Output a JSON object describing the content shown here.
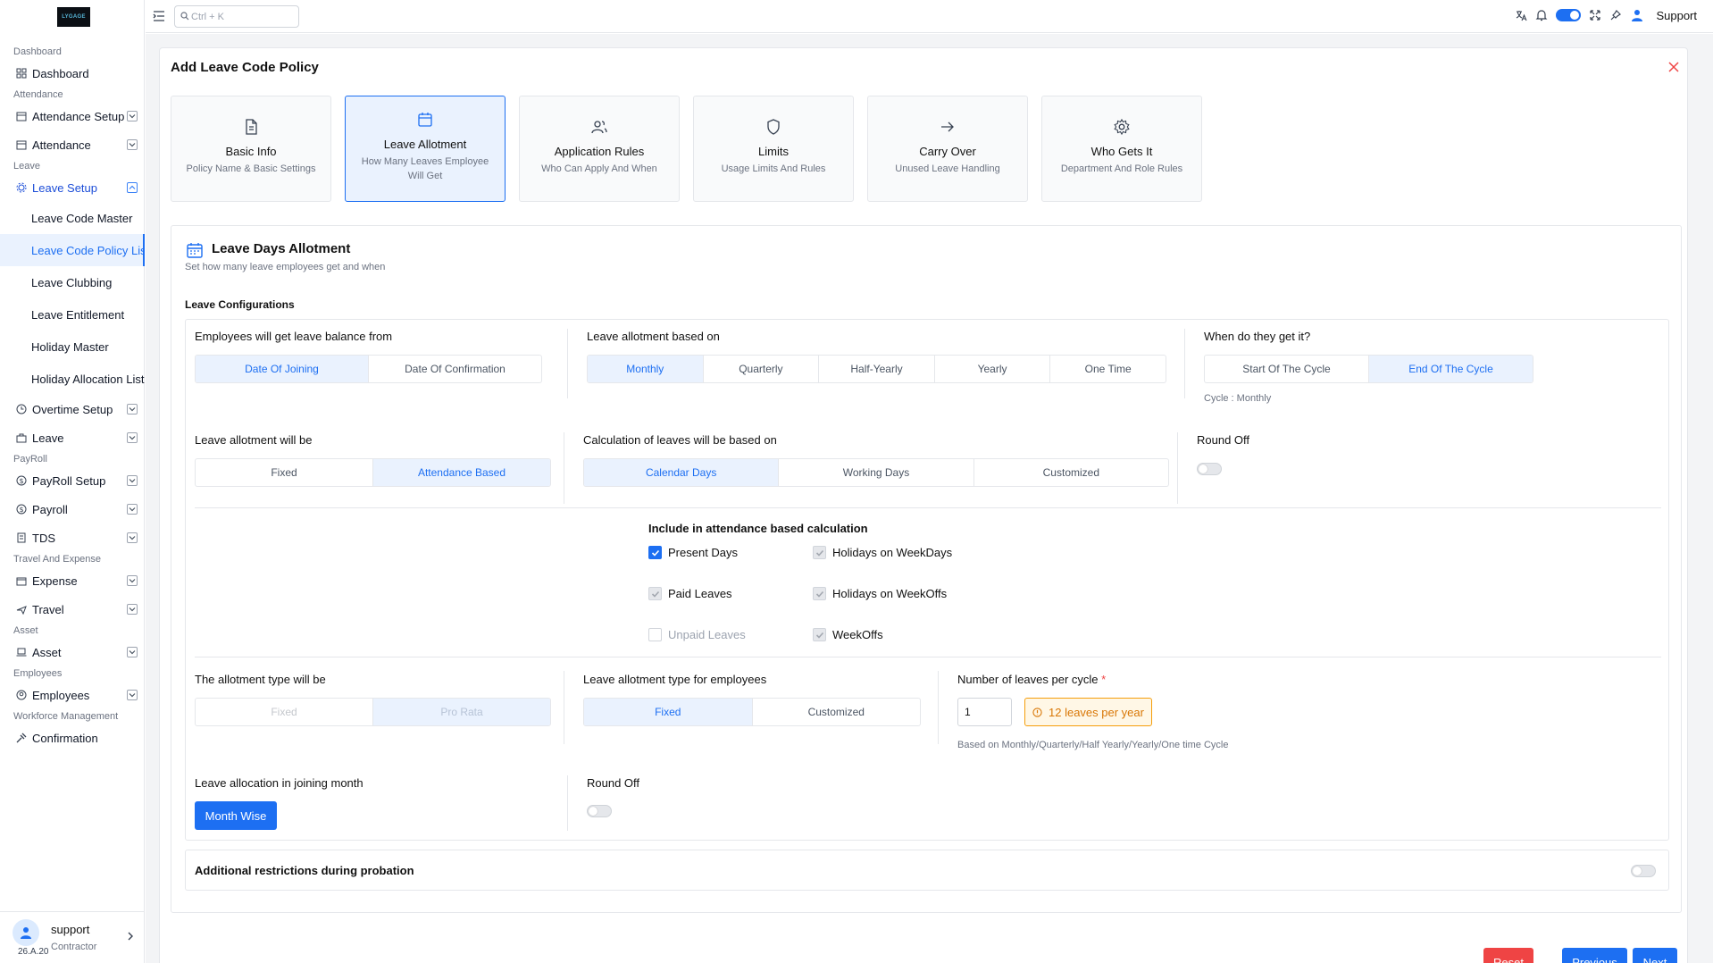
{
  "app": {
    "logo_text": "LYGAGE"
  },
  "topbar": {
    "search_placeholder": "Ctrl + K",
    "user_label": "Support"
  },
  "sidebar": {
    "sections": {
      "dashboard": "Dashboard",
      "attendance": "Attendance",
      "leave": "Leave",
      "payroll": "PayRoll",
      "travel": "Travel And Expense",
      "asset": "Asset",
      "employees": "Employees",
      "workforce": "Workforce Management"
    },
    "items": {
      "dashboard": "Dashboard",
      "attendance_setup": "Attendance Setup",
      "attendance": "Attendance",
      "leave_setup": "Leave Setup",
      "leave_code_master": "Leave Code Master",
      "leave_code_policy_list": "Leave Code Policy List",
      "leave_clubbing": "Leave Clubbing",
      "leave_entitlement": "Leave Entitlement",
      "holiday_master": "Holiday Master",
      "holiday_allocation_list": "Holiday Allocation List",
      "overtime_setup": "Overtime Setup",
      "leave": "Leave",
      "payroll_setup": "PayRoll Setup",
      "payroll": "Payroll",
      "tds": "TDS",
      "expense": "Expense",
      "travel": "Travel",
      "asset": "Asset",
      "employees": "Employees",
      "confirmation": "Confirmation"
    },
    "user": {
      "name": "support",
      "role": "Contractor",
      "version": "26.A.20"
    }
  },
  "page": {
    "title": "Add Leave Code Policy",
    "steps": [
      {
        "title": "Basic Info",
        "subtitle": "Policy Name & Basic Settings",
        "icon": "document-icon"
      },
      {
        "title": "Leave Allotment",
        "subtitle": "How Many Leaves Employee Will Get",
        "icon": "calendar-icon"
      },
      {
        "title": "Application Rules",
        "subtitle": "Who Can Apply And When",
        "icon": "users-icon"
      },
      {
        "title": "Limits",
        "subtitle": "Usage Limits And Rules",
        "icon": "shield-icon"
      },
      {
        "title": "Carry Over",
        "subtitle": "Unused Leave Handling",
        "icon": "arrow-right-icon"
      },
      {
        "title": "Who Gets It",
        "subtitle": "Department And Role Rules",
        "icon": "gear-icon"
      }
    ],
    "active_step": "Leave Allotment"
  },
  "allotment": {
    "title": "Leave Days Allotment",
    "subtitle": "Set how many leave employees get and when",
    "config_title": "Leave Configurations",
    "balance_from": {
      "label": "Employees will get leave balance from",
      "options": [
        "Date Of Joining",
        "Date Of Confirmation"
      ],
      "selected": "Date Of Joining"
    },
    "based_on": {
      "label": "Leave allotment based on",
      "options": [
        "Monthly",
        "Quarterly",
        "Half-Yearly",
        "Yearly",
        "One Time"
      ],
      "selected": "Monthly"
    },
    "when": {
      "label": "When do they get it?",
      "options": [
        "Start Of The Cycle",
        "End Of The Cycle"
      ],
      "selected": "End Of The Cycle",
      "cycle_note": "Cycle : Monthly"
    },
    "allotment_will_be": {
      "label": "Leave allotment will be",
      "options": [
        "Fixed",
        "Attendance Based"
      ],
      "selected": "Attendance Based"
    },
    "calc_based_on": {
      "label": "Calculation of leaves will be based on",
      "options": [
        "Calendar Days",
        "Working Days",
        "Customized"
      ],
      "selected": "Calendar Days"
    },
    "round_off_1": {
      "label": "Round Off",
      "on": false
    },
    "include": {
      "title": "Include in attendance based calculation",
      "items": [
        {
          "label": "Present Days",
          "state": "checked"
        },
        {
          "label": "Holidays on WeekDays",
          "state": "disabled-checked"
        },
        {
          "label": "Paid Leaves",
          "state": "disabled-checked"
        },
        {
          "label": "Holidays on WeekOffs",
          "state": "disabled-checked"
        },
        {
          "label": "Unpaid Leaves",
          "state": "disabled"
        },
        {
          "label": "WeekOffs",
          "state": "disabled-checked"
        }
      ]
    },
    "allotment_type": {
      "label": "The allotment type will be",
      "options": [
        "Fixed",
        "Pro Rata"
      ],
      "selected": "Pro Rata"
    },
    "type_for_employees": {
      "label": "Leave allotment type for employees",
      "options": [
        "Fixed",
        "Customized"
      ],
      "selected": "Fixed"
    },
    "leaves_per_cycle": {
      "label": "Number of leaves per cycle",
      "required_mark": "*",
      "value": "1",
      "summary": "12 leaves per year",
      "note": "Based on Monthly/Quarterly/Half Yearly/Yearly/One time Cycle"
    },
    "joining_month": {
      "label": "Leave allocation in joining month",
      "button": "Month Wise"
    },
    "round_off_2": {
      "label": "Round Off",
      "on": false
    },
    "probation": {
      "label": "Additional restrictions during probation",
      "on": false
    }
  },
  "footer": {
    "reset": "Reset",
    "previous": "Previous",
    "next": "Next"
  },
  "colors": {
    "accent": "#1d6ff2",
    "danger": "#ef4444",
    "warning": "#f59e0b"
  }
}
